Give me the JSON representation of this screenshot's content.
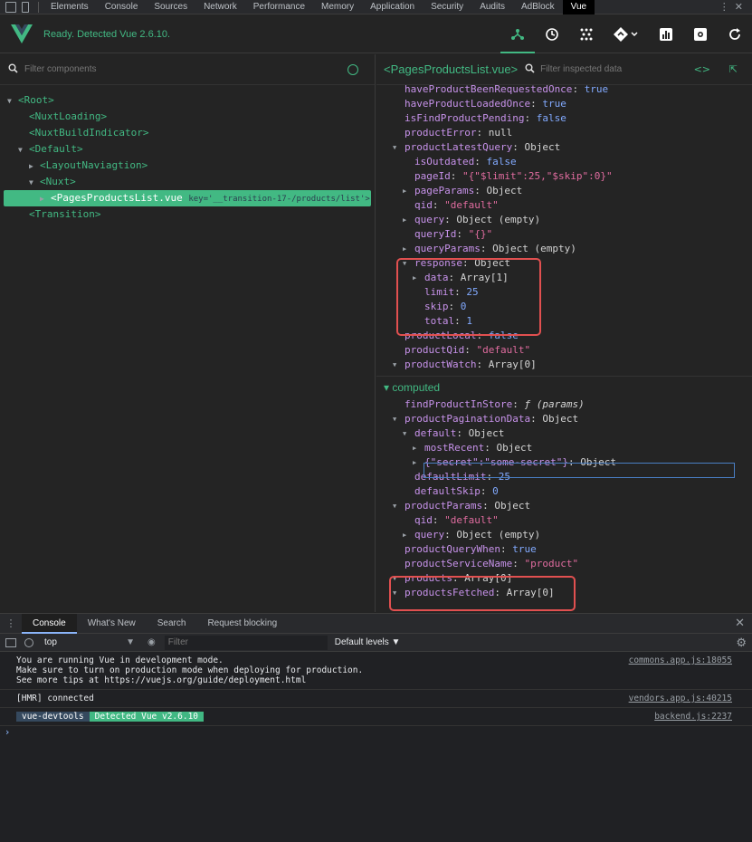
{
  "devtools_tabs": [
    "Elements",
    "Console",
    "Sources",
    "Network",
    "Performance",
    "Memory",
    "Application",
    "Security",
    "Audits",
    "AdBlock",
    "Vue"
  ],
  "active_devtools_tab": "Vue",
  "vue_status": "Ready. Detected Vue 2.6.10.",
  "colors": {
    "accent": "#42b983",
    "highlight": "#e15050",
    "key": "#c792ea",
    "string": "#e06c9f",
    "bool": "#82aaff"
  },
  "component_search_placeholder": "Filter components",
  "tree": [
    {
      "label": "<Root>",
      "indent": 0,
      "toggle": "▼"
    },
    {
      "label": "<NuxtLoading>",
      "indent": 1,
      "toggle": ""
    },
    {
      "label": "<NuxtBuildIndicator>",
      "indent": 1,
      "toggle": ""
    },
    {
      "label": "<Default>",
      "indent": 1,
      "toggle": "▼"
    },
    {
      "label": "<LayoutNaviagtion>",
      "indent": 2,
      "toggle": "▶"
    },
    {
      "label": "<Nuxt>",
      "indent": 2,
      "toggle": "▼"
    },
    {
      "label": "<PagesProductsList.vue",
      "key": "key='__transition-17-/products/list'> = $",
      "indent": 3,
      "toggle": "▶",
      "selected": true
    },
    {
      "label": "<Transition>",
      "indent": 1,
      "toggle": ""
    }
  ],
  "inspected_component": "<PagesProductsList.vue>",
  "inspected_search_placeholder": "Filter inspected data",
  "data_rows": [
    {
      "k": "haveProductBeenRequestedOnce",
      "v": "true",
      "t": "b",
      "i": 1
    },
    {
      "k": "haveProductLoadedOnce",
      "v": "true",
      "t": "b",
      "i": 1
    },
    {
      "k": "isFindProductPending",
      "v": "false",
      "t": "b",
      "i": 1
    },
    {
      "k": "productError",
      "v": "null",
      "t": "v",
      "i": 1
    },
    {
      "k": "productLatestQuery",
      "v": "Object",
      "t": "v",
      "i": 1,
      "tog": "▼"
    },
    {
      "k": "isOutdated",
      "v": "false",
      "t": "b",
      "i": 2
    },
    {
      "k": "pageId",
      "v": "\"{\"$limit\":25,\"$skip\":0}\"",
      "t": "s",
      "i": 2
    },
    {
      "k": "pageParams",
      "v": "Object",
      "t": "v",
      "i": 2,
      "tog": "▶"
    },
    {
      "k": "qid",
      "v": "\"default\"",
      "t": "s",
      "i": 2
    },
    {
      "k": "query",
      "v": "Object (empty)",
      "t": "v",
      "i": 2,
      "tog": "▶"
    },
    {
      "k": "queryId",
      "v": "\"{}\"",
      "t": "s",
      "i": 2
    },
    {
      "k": "queryParams",
      "v": "Object (empty)",
      "t": "v",
      "i": 2,
      "tog": "▶"
    },
    {
      "k": "response",
      "v": "Object",
      "t": "v",
      "i": 2,
      "tog": "▼"
    },
    {
      "k": "data",
      "v": "Array[1]",
      "t": "v",
      "i": 3,
      "tog": "▶"
    },
    {
      "k": "limit",
      "v": "25",
      "t": "b",
      "i": 3
    },
    {
      "k": "skip",
      "v": "0",
      "t": "b",
      "i": 3
    },
    {
      "k": "total",
      "v": "1",
      "t": "b",
      "i": 3
    },
    {
      "k": "productLocal",
      "v": "false",
      "t": "b",
      "i": 1
    },
    {
      "k": "productQid",
      "v": "\"default\"",
      "t": "s",
      "i": 1
    },
    {
      "k": "productWatch",
      "v": "Array[0]",
      "t": "v",
      "i": 1,
      "tog": "▼"
    }
  ],
  "computed_label": "computed",
  "computed_rows": [
    {
      "k": "findProductInStore",
      "v": "ƒ (params)",
      "t": "fn",
      "i": 1
    },
    {
      "k": "productPaginationData",
      "v": "Object",
      "t": "v",
      "i": 1,
      "tog": "▼"
    },
    {
      "k": "default",
      "v": "Object",
      "t": "v",
      "i": 2,
      "tog": "▼"
    },
    {
      "k": "mostRecent",
      "v": "Object",
      "t": "v",
      "i": 3,
      "tog": "▶"
    },
    {
      "k": "{\"secret\":\"some-secret\"}",
      "v": "Object",
      "t": "v",
      "i": 3,
      "tog": "▶"
    },
    {
      "k": "defaultLimit",
      "v": "25",
      "t": "b",
      "i": 2
    },
    {
      "k": "defaultSkip",
      "v": "0",
      "t": "b",
      "i": 2
    },
    {
      "k": "productParams",
      "v": "Object",
      "t": "v",
      "i": 1,
      "tog": "▼"
    },
    {
      "k": "qid",
      "v": "\"default\"",
      "t": "s",
      "i": 2
    },
    {
      "k": "query",
      "v": "Object (empty)",
      "t": "v",
      "i": 2,
      "tog": "▶"
    },
    {
      "k": "productQueryWhen",
      "v": "true",
      "t": "b",
      "i": 1
    },
    {
      "k": "productServiceName",
      "v": "\"product\"",
      "t": "s",
      "i": 1
    },
    {
      "k": "products",
      "v": "Array[0]",
      "t": "v",
      "i": 1,
      "tog": "▼"
    },
    {
      "k": "productsFetched",
      "v": "Array[0]",
      "t": "v",
      "i": 1,
      "tog": "▼"
    }
  ],
  "console_tabs": [
    "Console",
    "What's New",
    "Search",
    "Request blocking"
  ],
  "console_context": "top",
  "console_filter_placeholder": "Filter",
  "console_levels": "Default levels ▼",
  "messages": [
    {
      "lines": [
        "You are running Vue in development mode.",
        "Make sure to turn on production mode when deploying for production.",
        "See more tips at "
      ],
      "link": "https://vuejs.org/guide/deployment.html",
      "src": "commons.app.js:18055"
    },
    {
      "lines": [
        "[HMR] connected"
      ],
      "src": "vendors.app.js:40215"
    },
    {
      "badge1": "vue-devtools",
      "badge2": "Detected Vue v2.6.10",
      "src": "backend.js:2237"
    }
  ]
}
